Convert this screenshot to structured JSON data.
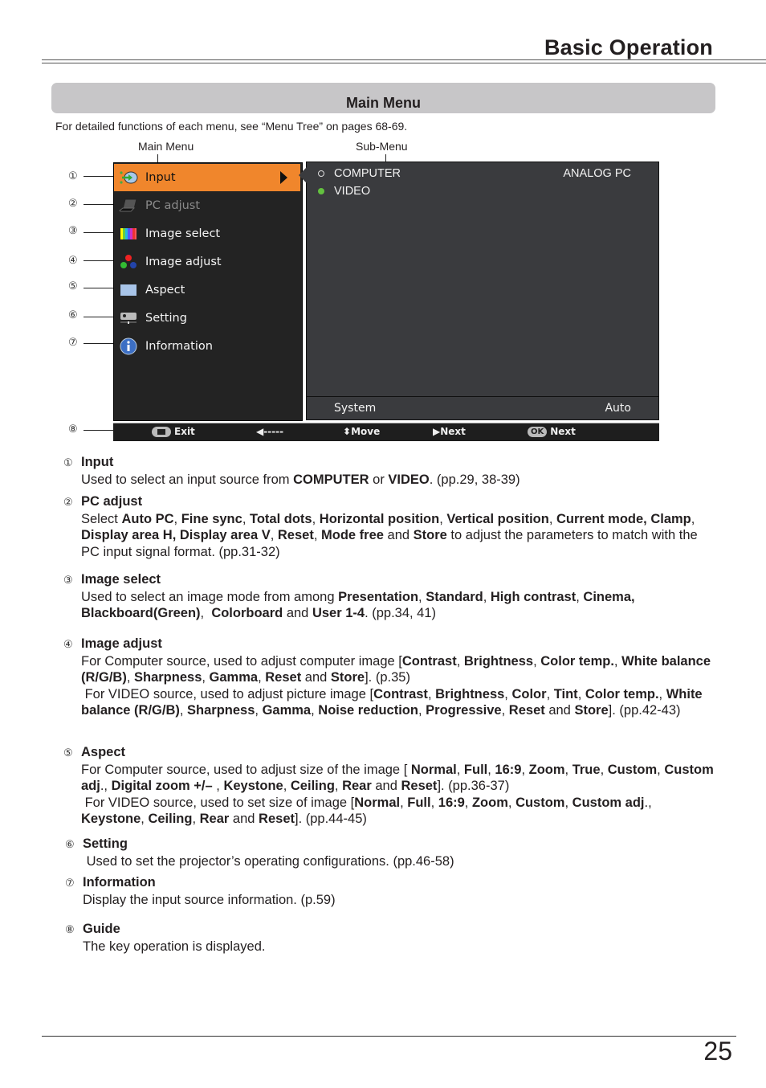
{
  "header": {
    "title": "Basic Operation"
  },
  "section": {
    "title": "Main Menu",
    "intro": "For detailed functions of each menu, see “Menu Tree” on pages 68-69."
  },
  "callouts": {
    "main_menu": "Main Menu",
    "sub_menu": "Sub-Menu"
  },
  "numbers": [
    "①",
    "②",
    "③",
    "④",
    "⑤",
    "⑥",
    "⑦",
    "⑧"
  ],
  "osd": {
    "main_items": [
      {
        "label": "Input",
        "icon": "input-arrow-icon",
        "state": "active"
      },
      {
        "label": "PC adjust",
        "icon": "laptop-icon",
        "state": "disabled"
      },
      {
        "label": "Image select",
        "icon": "color-bars-icon",
        "state": "normal"
      },
      {
        "label": "Image adjust",
        "icon": "rgb-dots-icon",
        "state": "normal"
      },
      {
        "label": "Aspect",
        "icon": "aspect-rect-icon",
        "state": "normal"
      },
      {
        "label": "Setting",
        "icon": "projector-icon",
        "state": "normal"
      },
      {
        "label": "Information",
        "icon": "info-icon",
        "state": "normal"
      }
    ],
    "sub_items": [
      {
        "label": "COMPUTER",
        "value": "ANALOG PC",
        "selected": false
      },
      {
        "label": "VIDEO",
        "value": "",
        "selected": true
      }
    ],
    "system": {
      "label": "System",
      "value": "Auto"
    },
    "guide": {
      "exit": "Exit",
      "back": "-----",
      "move": "Move",
      "next": "Next",
      "ok": "OK",
      "ok_next": "Next"
    },
    "colors": {
      "active": "#f0862c",
      "selected_radio": "#63c13f"
    }
  },
  "descriptions": [
    {
      "num": "①",
      "title": "Input",
      "lines": [
        "Used to select an input source from <b>COMPUTER</b> or <b>VIDEO</b>. (pp.29, 38-39)"
      ]
    },
    {
      "num": "②",
      "title": "PC adjust",
      "lines": [
        "Select <b>Auto PC</b>, <b>Fine sync</b>, <b>Total dots</b>, <b>Horizontal position</b>, <b>Vertical position</b>, <b>Current mode, Clamp</b>, <b>Display area H, Display area V</b>, <b>Reset</b>, <b>Mode free</b> and <b>Store</b> to adjust the parameters to match with the PC input signal format. (pp.31-32)"
      ]
    },
    {
      "num": "③",
      "title": "Image select",
      "lines": [
        "Used to select an image mode from among <b>Presentation</b>, <b>Standard</b>, <b>High contrast</b>, <b>Cinema, Blackboard(Green)</b>,&nbsp; <b>Colorboard</b> and <b>User 1-4</b>. (pp.34, 41)"
      ]
    },
    {
      "num": "④",
      "title": "Image adjust",
      "lines": [
        "For Computer source, used to adjust computer image [<b>Contrast</b>, <b>Brightness</b>, <b>Color temp.</b>, <b>White balance (R/G/B)</b>, <b>Sharpness</b>, <b>Gamma</b>, <b>Reset</b> and <b>Store</b>]. (p.35)",
        "&nbsp;For VIDEO source, used to adjust picture image [<b>Contrast</b>, <b>Brightness</b>, <b>Color</b>, <b>Tint</b>, <b>Color temp.</b>, <b>White balance (R/G/B)</b>, <b>Sharpness</b>, <b>Gamma</b>, <b>Noise reduction</b>, <b>Progressive</b>, <b>Reset</b> and <b>Store</b>]. (pp.42-43)"
      ]
    },
    {
      "num": "⑤",
      "title": "Aspect",
      "lines": [
        "For Computer source, used to adjust size of the image [ <b>Normal</b>, <b>Full</b>, <b>16:9</b>, <b>Zoom</b>, <b>True</b>, <b>Custom</b>, <b>Custom adj</b>., <b>Digital zoom +/–</b> , <b>Keystone</b>, <b>Ceiling</b>, <b>Rear</b> and <b>Reset</b>]. (pp.36-37)",
        "&nbsp;For VIDEO source, used to set size of image [<b>Normal</b>, <b>Full</b>, <b>16:9</b>, <b>Zoom</b>, <b>Custom</b>, <b>Custom adj</b>., <b>Keystone</b>, <b>Ceiling</b>, <b>Rear</b> and <b>Reset</b>]. (pp.44-45)"
      ]
    },
    {
      "num": "⑥",
      "title": "Setting",
      "lines": [
        "&nbsp;Used to set the projector’s operating configurations. (pp.46-58)"
      ]
    },
    {
      "num": "⑦",
      "title": "Information",
      "lines": [
        "Display the input source information. (p.59)"
      ]
    },
    {
      "num": "⑧",
      "title": "Guide",
      "lines": [
        "The key operation is displayed."
      ]
    }
  ],
  "footer": {
    "page_number": "25"
  }
}
